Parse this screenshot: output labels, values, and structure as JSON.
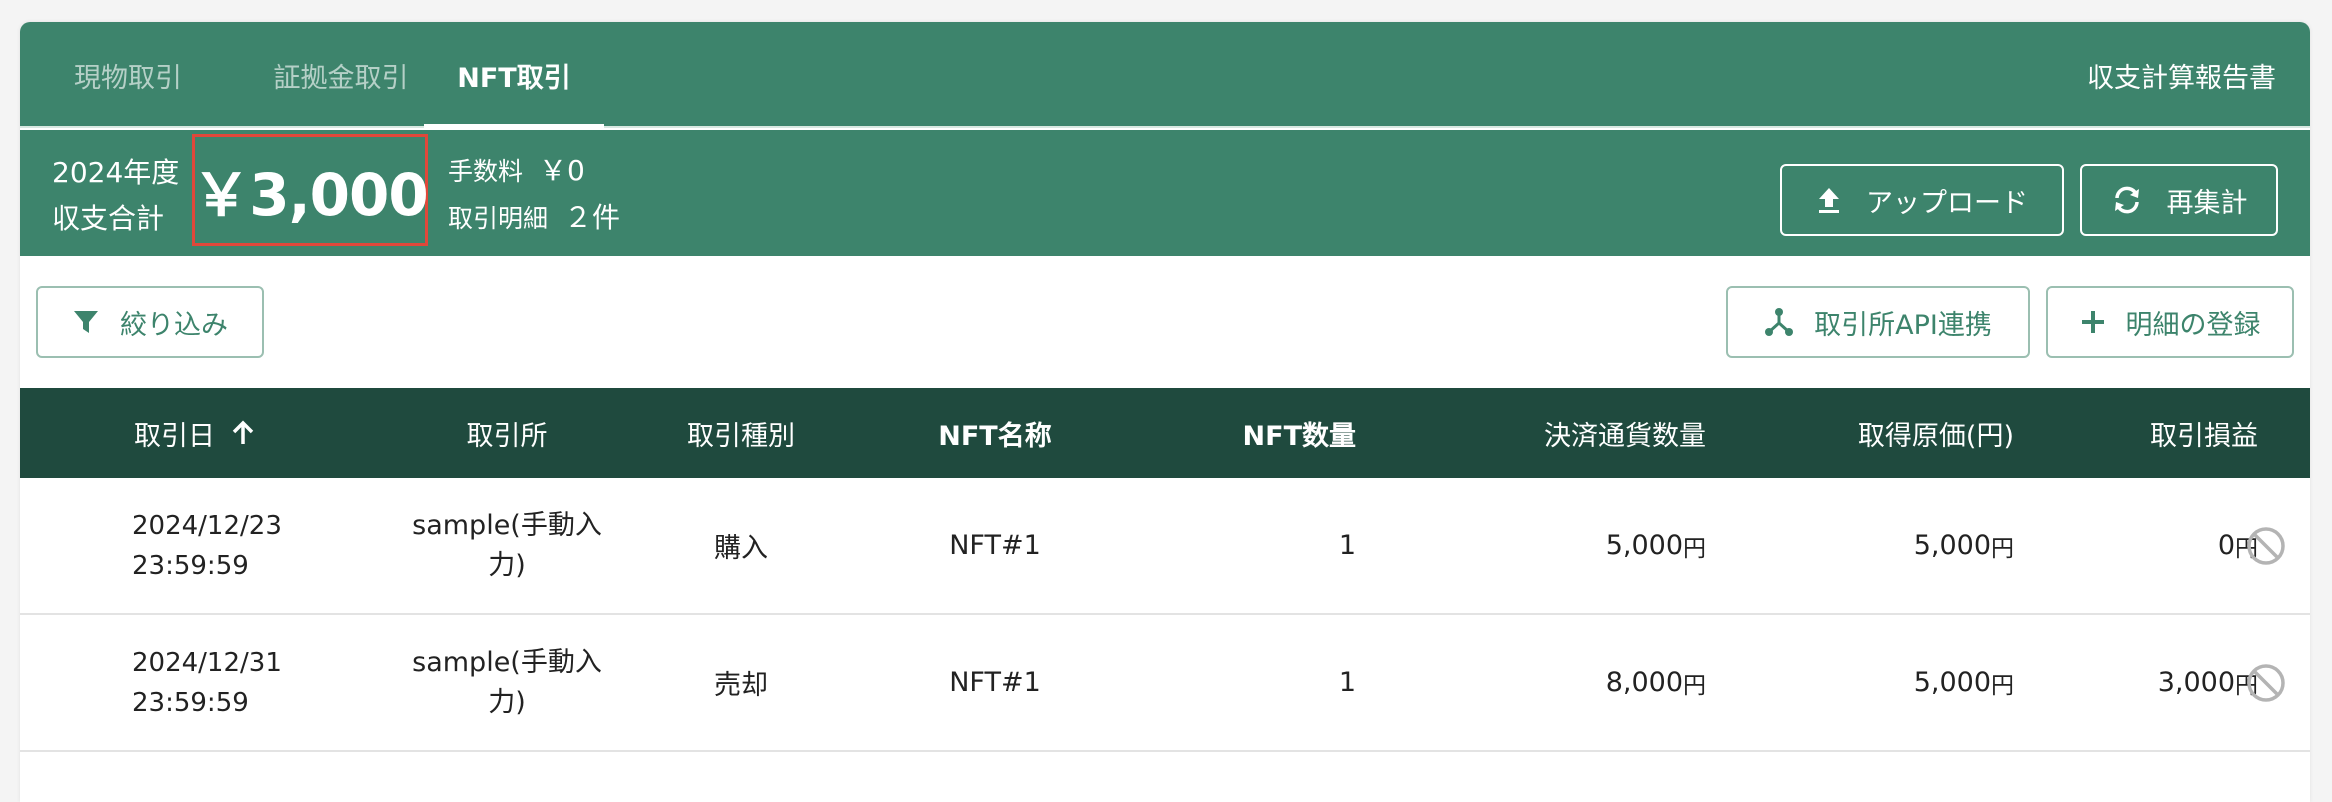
{
  "tabs": [
    {
      "label": "現物取引",
      "active": false
    },
    {
      "label": "証拠金取引",
      "active": false
    },
    {
      "label": "NFT取引",
      "active": true
    }
  ],
  "report_link": "収支計算報告書",
  "summary": {
    "year_line1": "2024年度",
    "year_line2": "収支合計",
    "total": "￥3,000",
    "fee_label": "手数料",
    "fee_value": "￥0",
    "count_label": "取引明細",
    "count_value": "２件",
    "upload_label": "アップロード",
    "recalc_label": "再集計"
  },
  "toolbar": {
    "filter_label": "絞り込み",
    "api_label": "取引所API連携",
    "add_label": "明細の登録"
  },
  "table": {
    "columns": [
      "取引日",
      "取引所",
      "取引種別",
      "NFT名称",
      "NFT数量",
      "決済通貨数量",
      "取得原価(円)",
      "取引損益"
    ],
    "rows": [
      {
        "date_line1": "2024/12/23",
        "date_line2": "23:59:59",
        "exchange_line1": "sample(手動入",
        "exchange_line2": "力)",
        "type": "購入",
        "nft_name": "NFT#1",
        "nft_qty": "1",
        "settle_amount": "5,000",
        "cost": "5,000",
        "pnl": "0"
      },
      {
        "date_line1": "2024/12/31",
        "date_line2": "23:59:59",
        "exchange_line1": "sample(手動入",
        "exchange_line2": "力)",
        "type": "売却",
        "nft_name": "NFT#1",
        "nft_qty": "1",
        "settle_amount": "8,000",
        "cost": "5,000",
        "pnl": "3,000"
      }
    ],
    "currency_unit": "円"
  },
  "colors": {
    "header_green": "#3d846c",
    "table_head": "#1f4a3e",
    "highlight_border": "#e0483a"
  },
  "icons": [
    "upload-icon",
    "refresh-icon",
    "filter-icon",
    "api-connect-icon",
    "plus-icon",
    "sort-arrow-up-icon",
    "ban-icon"
  ]
}
